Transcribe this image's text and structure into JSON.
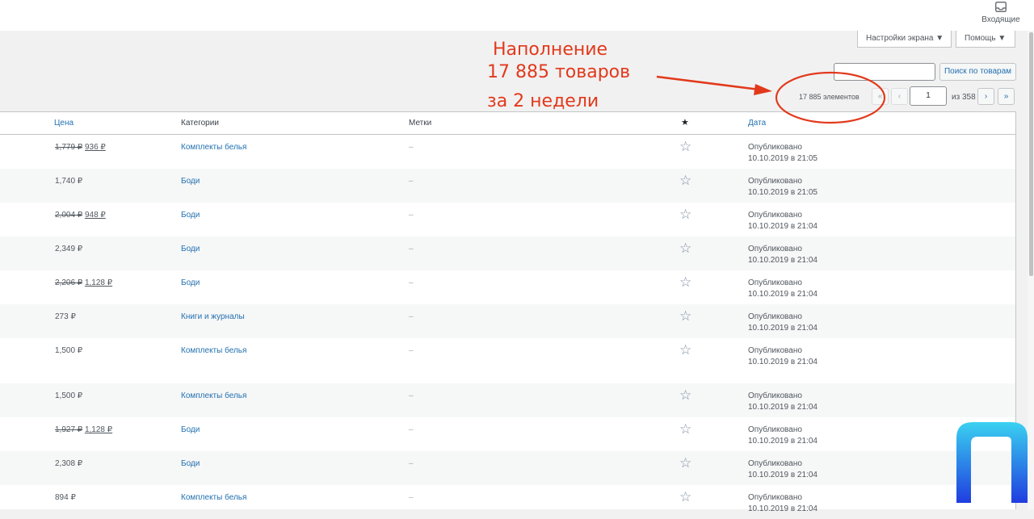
{
  "topbar": {
    "inbox_label": "Входящие",
    "inbox_icon": "inbox-icon"
  },
  "screen_options": {
    "settings_label": "Настройки экрана ▼",
    "help_label": "Помощь ▼"
  },
  "search": {
    "value": "",
    "button_label": "Поиск по товарам"
  },
  "pagination": {
    "count": "17 885 элементов",
    "first": "«",
    "prev": "‹",
    "current_page": "1",
    "of_total": "из 358",
    "next": "›",
    "last": "»"
  },
  "columns": {
    "price": "Цена",
    "categories": "Категории",
    "tags": "Метки",
    "featured_icon": "star-icon",
    "date": "Дата"
  },
  "rows": [
    {
      "old_price": "1,779 ₽",
      "price": "936 ₽",
      "category": "Комплекты белья",
      "tags": "–",
      "status": "Опубликовано",
      "date": "10.10.2019 в 21:05"
    },
    {
      "old_price": "",
      "price": "1,740 ₽",
      "category": "Боди",
      "tags": "–",
      "status": "Опубликовано",
      "date": "10.10.2019 в 21:05"
    },
    {
      "old_price": "2,004 ₽",
      "price": "948 ₽",
      "category": "Боди",
      "tags": "–",
      "status": "Опубликовано",
      "date": "10.10.2019 в 21:04"
    },
    {
      "old_price": "",
      "price": "2,349 ₽",
      "category": "Боди",
      "tags": "–",
      "status": "Опубликовано",
      "date": "10.10.2019 в 21:04"
    },
    {
      "old_price": "2,206 ₽",
      "price": "1,128 ₽",
      "category": "Боди",
      "tags": "–",
      "status": "Опубликовано",
      "date": "10.10.2019 в 21:04"
    },
    {
      "old_price": "",
      "price": "273 ₽",
      "category": "Книги и журналы",
      "tags": "–",
      "status": "Опубликовано",
      "date": "10.10.2019 в 21:04"
    },
    {
      "old_price": "",
      "price": "1,500 ₽",
      "category": "Комплекты белья",
      "tags": "–",
      "status": "Опубликовано",
      "date": "10.10.2019 в 21:04"
    },
    {
      "old_price": "",
      "price": "1,500 ₽",
      "category": "Комплекты белья",
      "tags": "–",
      "status": "Опубликовано",
      "date": "10.10.2019 в 21:04"
    },
    {
      "old_price": "1,927 ₽",
      "price": "1,128 ₽",
      "category": "Боди",
      "tags": "–",
      "status": "Опубликовано",
      "date": "10.10.2019 в 21:04"
    },
    {
      "old_price": "",
      "price": "2,308 ₽",
      "category": "Боди",
      "tags": "–",
      "status": "Опубликовано",
      "date": "10.10.2019 в 21:04"
    },
    {
      "old_price": "",
      "price": "894 ₽",
      "category": "Комплекты белья",
      "tags": "–",
      "status": "Опубликовано",
      "date": "10.10.2019 в 21:04"
    }
  ],
  "annotation": {
    "line1": "Наполнение",
    "line2": "17 885 товаров",
    "line3": "за 2 недели",
    "color": "#e2391c"
  },
  "colors": {
    "link": "#2271b1",
    "alt_row": "#f6f7f7",
    "logo_gradient_top": "#3ad1f0",
    "logo_gradient_bottom": "#1f3de0"
  }
}
